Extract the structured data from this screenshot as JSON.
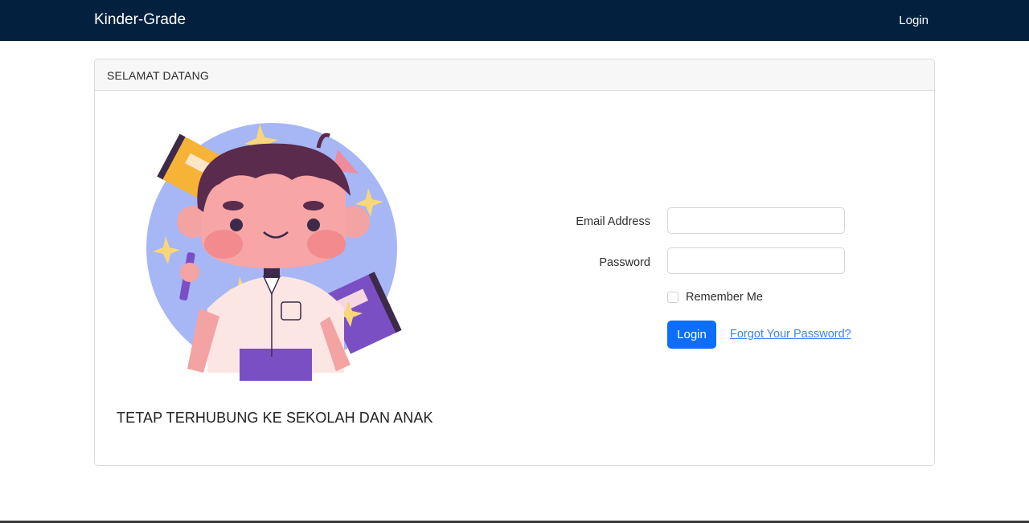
{
  "navbar": {
    "brand": "Kinder-Grade",
    "login_link": "Login",
    "background": "#03203f"
  },
  "card": {
    "header_title": "SELAMAT DATANG",
    "tagline": "TETAP TERHUBUNG KE SEKOLAH DAN ANAK"
  },
  "form": {
    "email_label": "Email Address",
    "email_value": "",
    "password_label": "Password",
    "password_value": "",
    "remember_label": "Remember Me",
    "remember_checked": false,
    "submit_label": "Login",
    "forgot_label": "Forgot Your Password?",
    "accent": "#0d6efd"
  },
  "illustration": {
    "subject": "kid-student-illustration"
  }
}
